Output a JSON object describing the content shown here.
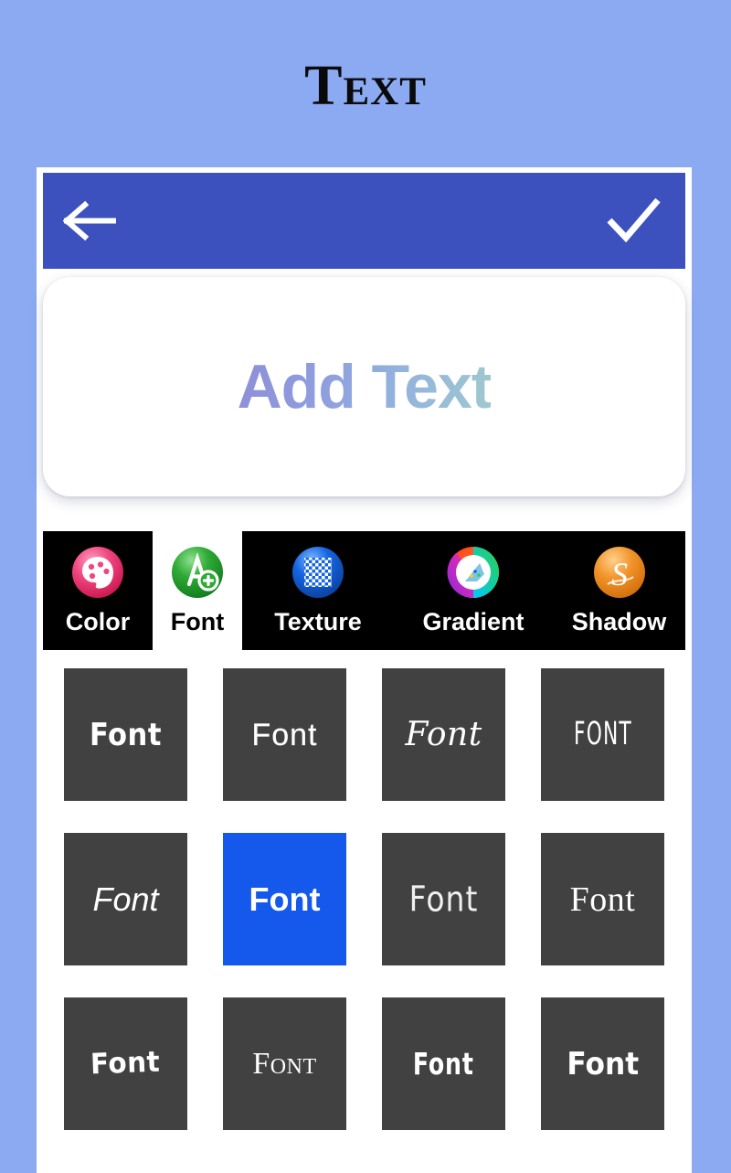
{
  "page": {
    "title": "Text",
    "background_color": "#8BAAF2"
  },
  "toolbar": {
    "back_icon": "arrow-left-icon",
    "confirm_icon": "check-icon",
    "background_color": "#3C51BD"
  },
  "text_card": {
    "placeholder": "Add Text"
  },
  "tabs": [
    {
      "label": "Color",
      "icon": "palette-icon",
      "selected": false,
      "icon_color": "#EC4070"
    },
    {
      "label": "Font",
      "icon": "font-add-icon",
      "selected": true,
      "icon_color": "#2FA32F"
    },
    {
      "label": "Texture",
      "icon": "checkerboard-icon",
      "selected": false,
      "icon_color": "#1565E0"
    },
    {
      "label": "Gradient",
      "icon": "color-wheel-icon",
      "selected": false,
      "icon_color": "#E0E0E0"
    },
    {
      "label": "Shadow",
      "icon": "shadow-s-icon",
      "selected": false,
      "icon_color": "#F0942A"
    }
  ],
  "font_grid": {
    "tile_background": "#414141",
    "selected_color": "#1558EC",
    "tiles": [
      {
        "label": "Font",
        "selected": false
      },
      {
        "label": "Font",
        "selected": false
      },
      {
        "label": "Font",
        "selected": false
      },
      {
        "label": "FONT",
        "selected": false
      },
      {
        "label": "Font",
        "selected": false
      },
      {
        "label": "Font",
        "selected": true
      },
      {
        "label": "Font",
        "selected": false
      },
      {
        "label": "Font",
        "selected": false
      },
      {
        "label": "Font",
        "selected": false
      },
      {
        "label": "Font",
        "selected": false
      },
      {
        "label": "Font",
        "selected": false
      },
      {
        "label": "Font",
        "selected": false
      }
    ]
  }
}
